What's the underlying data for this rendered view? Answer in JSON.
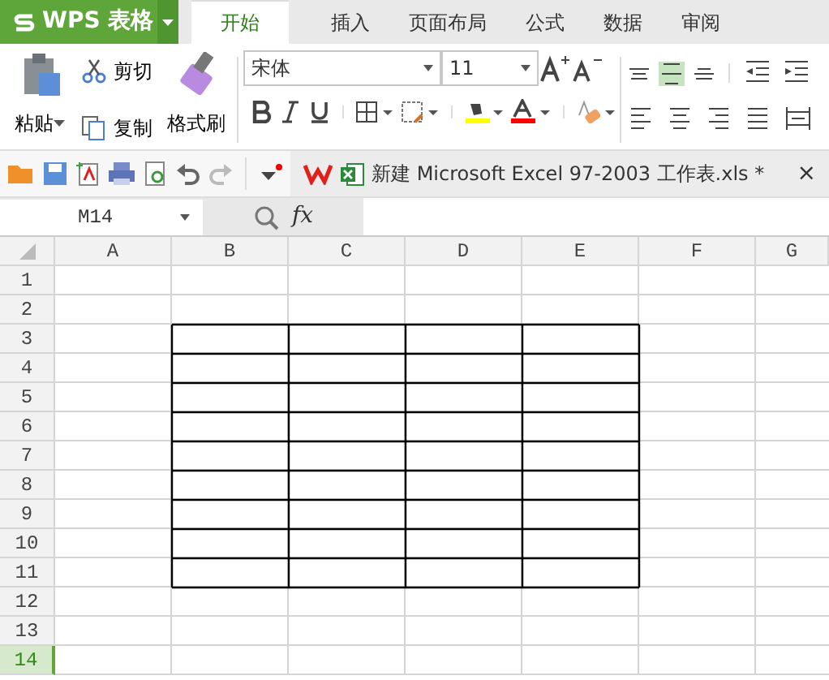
{
  "app_button": {
    "label": "WPS 表格"
  },
  "tabs": [
    {
      "label": "开始",
      "selected": true
    },
    {
      "label": "插入",
      "selected": false
    },
    {
      "label": "页面布局",
      "selected": false
    },
    {
      "label": "公式",
      "selected": false
    },
    {
      "label": "数据",
      "selected": false
    },
    {
      "label": "审阅",
      "selected": false
    }
  ],
  "clipboard": {
    "paste": "粘贴",
    "cut": "剪切",
    "copy": "复制",
    "format_painter": "格式刷"
  },
  "font": {
    "name": "宋体",
    "size": "11"
  },
  "alignment_buttons": [
    {
      "kind": "top",
      "selected": false
    },
    {
      "kind": "middle",
      "selected": true
    },
    {
      "kind": "bottom",
      "selected": false
    },
    {
      "kind": "outdent",
      "selected": false
    },
    {
      "kind": "indent",
      "selected": false
    },
    {
      "kind": "left",
      "selected": false
    },
    {
      "kind": "center",
      "selected": false
    },
    {
      "kind": "right",
      "selected": false
    },
    {
      "kind": "justify",
      "selected": false
    },
    {
      "kind": "distributed",
      "selected": false
    }
  ],
  "document_tab": {
    "title": "新建 Microsoft Excel 97-2003 工作表.xls *",
    "close": "×"
  },
  "formula_bar": {
    "name_box": "M14",
    "fx": "fx"
  },
  "grid": {
    "columns": [
      {
        "label": "A",
        "selected": false
      },
      {
        "label": "B",
        "selected": false
      },
      {
        "label": "C",
        "selected": false
      },
      {
        "label": "D",
        "selected": false
      },
      {
        "label": "E",
        "selected": false
      },
      {
        "label": "F",
        "selected": false
      },
      {
        "label": "G",
        "selected": false
      }
    ],
    "rows": [
      {
        "label": "1",
        "selected": false
      },
      {
        "label": "2",
        "selected": false
      },
      {
        "label": "3",
        "selected": false
      },
      {
        "label": "4",
        "selected": false
      },
      {
        "label": "5",
        "selected": false
      },
      {
        "label": "6",
        "selected": false
      },
      {
        "label": "7",
        "selected": false
      },
      {
        "label": "8",
        "selected": false
      },
      {
        "label": "9",
        "selected": false
      },
      {
        "label": "10",
        "selected": false
      },
      {
        "label": "11",
        "selected": false
      },
      {
        "label": "12",
        "selected": false
      },
      {
        "label": "13",
        "selected": false
      },
      {
        "label": "14",
        "selected": true
      }
    ]
  }
}
